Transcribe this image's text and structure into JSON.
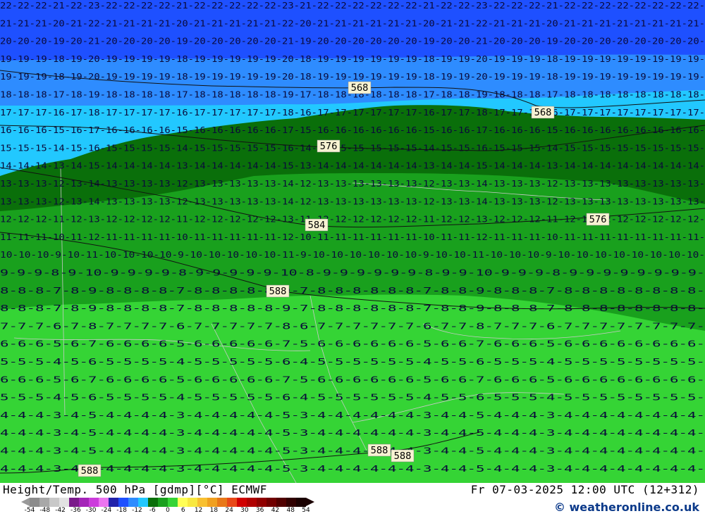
{
  "map": {
    "height_labels": [
      "568",
      "568",
      "576",
      "576",
      "584",
      "588",
      "588",
      "588",
      "588"
    ],
    "colors": {
      "t_minus30": "#1e50ff",
      "t_minus24": "#2e8cff",
      "t_minus18": "#22c8ff",
      "t_minus12": "#0a6f0a",
      "t_minus6": "#19a01d",
      "t_0": "#35d435",
      "contour": "#111111",
      "border": "#c8c8c8",
      "label_bg": "#f7f2d2"
    }
  },
  "footer": {
    "title": "Height/Temp. 500 hPa [gdmp][°C] ECMWF",
    "valid": "Fr 07-03-2025 12:00 UTC (12+312)",
    "copyright": "© weatheronline.co.uk",
    "legend": {
      "ticks": [
        "-54",
        "-48",
        "-42",
        "-36",
        "-30",
        "-24",
        "-18",
        "-12",
        "-6",
        "0",
        "6",
        "12",
        "18",
        "24",
        "30",
        "36",
        "42",
        "48",
        "54"
      ],
      "colors": [
        "#8c8c8c",
        "#a8a8a8",
        "#c8c8c8",
        "#e2e2e2",
        "#7a1a8a",
        "#a424b8",
        "#cc3cdc",
        "#ec74f0",
        "#2222aa",
        "#1e50ff",
        "#2e8cff",
        "#22c8ff",
        "#0a6f0a",
        "#19a01d",
        "#35d435",
        "#ffff55",
        "#f8e840",
        "#f8c030",
        "#f0a020",
        "#e87818",
        "#e84818",
        "#d00000",
        "#b00000",
        "#900000",
        "#700000",
        "#500000",
        "#300000",
        "#1a0000"
      ]
    }
  }
}
